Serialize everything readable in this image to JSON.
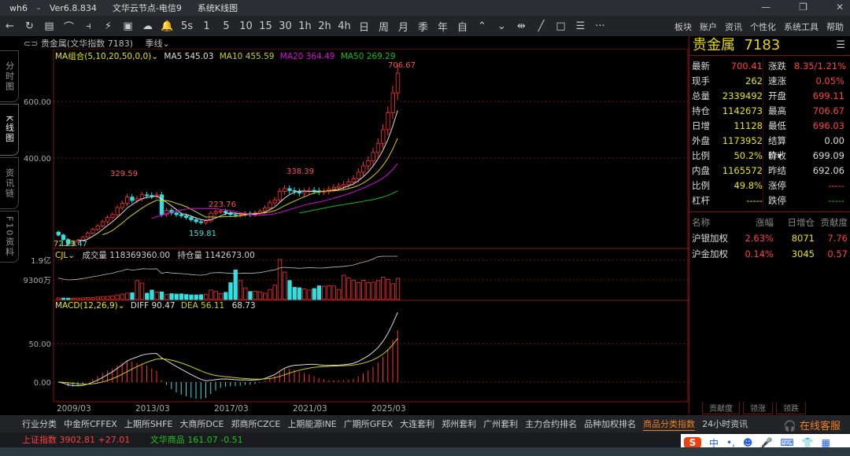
{
  "window": {
    "app": "wh6",
    "version": "Ver6.8.834",
    "server": "文华云节点-电信9",
    "view": "系统K线图"
  },
  "toolbar": {
    "buttons": [
      "←",
      "↻",
      "▤",
      "⌒",
      "⫞",
      "⚡",
      "▣",
      "☁",
      "🔔",
      "5s",
      "1",
      "5",
      "10",
      "15",
      "30",
      "1h",
      "2h",
      "4h",
      "日",
      "周",
      "月",
      "季",
      "年",
      "自",
      "⌃",
      "⌄",
      "⇹",
      "╱",
      "□",
      "☰",
      "···"
    ],
    "menus": [
      "板块",
      "账户",
      "资讯",
      "个性化",
      "系统工具",
      "帮助"
    ]
  },
  "side_tabs": [
    "分时图",
    "K线图",
    "资讯链",
    "F10资料"
  ],
  "instrument": {
    "name": "贵金属(文华指数 7183)",
    "period": "季线"
  },
  "ma_legend": {
    "label": "MA组合(5,10,20,50,0,0)",
    "ma5": "MA5 545.03",
    "ma10": "MA10 455.59",
    "ma20": "MA20 364.49",
    "ma50": "MA50 269.29"
  },
  "vol_legend": {
    "label": "CJL",
    "volume": "成交量 118369360.00",
    "oi": "持仓量 1142673.00"
  },
  "macd_legend": {
    "label": "MACD(12,26,9)",
    "diff": "DIFF 90.47",
    "dea": "DEA 56.11",
    "macd": "68.73"
  },
  "colors": {
    "up": "#ff3030",
    "down": "#30e0e0",
    "ma5": "#dddddd",
    "ma10": "#d0d000",
    "ma20": "#e000e0",
    "ma50": "#10c010"
  },
  "chart_data": {
    "type": "candlestick",
    "price_axis": {
      "ticks": [
        "600.00",
        "400.00"
      ],
      "range": [
        60,
        720
      ]
    },
    "vol_axis": {
      "ticks": [
        "1.9亿",
        "9300万"
      ]
    },
    "macd_axis": {
      "ticks": [
        "50.00",
        "0.00"
      ]
    },
    "x_ticks": [
      "2009/03",
      "2013/03",
      "2017/03",
      "2021/03",
      "2025/03"
    ],
    "annotations": {
      "high": "706.67",
      "low_first": "72.23",
      "low_first_b": "123.47",
      "peak2011": "329.59",
      "low2016": "159.81",
      "high2016": "223.76",
      "peak2020": "338.39"
    },
    "closes": [
      128,
      112,
      96,
      104,
      110,
      120,
      135,
      148,
      160,
      175,
      190,
      200,
      225,
      240,
      262,
      250,
      256,
      270,
      268,
      266,
      270,
      200,
      215,
      206,
      200,
      196,
      190,
      182,
      175,
      172,
      178,
      205,
      210,
      212,
      206,
      200,
      198,
      200,
      204,
      200,
      206,
      212,
      224,
      242,
      252,
      282,
      292,
      285,
      282,
      276,
      282,
      286,
      284,
      280,
      282,
      290,
      296,
      300,
      306,
      315,
      326,
      350,
      372,
      390,
      420,
      452,
      500,
      560,
      630,
      700
    ],
    "volumes": [
      800,
      700,
      650,
      600,
      700,
      800,
      900,
      1000,
      1200,
      1400,
      1500,
      1800,
      2200,
      2600,
      3000,
      3200,
      9000,
      7800,
      3000,
      4500,
      3500,
      3600,
      2500,
      2800,
      2600,
      2700,
      2400,
      2200,
      2200,
      2300,
      2500,
      4500,
      3800,
      2800,
      3400,
      8000,
      14000,
      9000,
      5500,
      3800,
      4000,
      3500,
      3000,
      4800,
      6800,
      19000,
      13000,
      9000,
      5800,
      5600,
      5000,
      4500,
      5200,
      6500,
      6300,
      6600,
      6400,
      4800,
      11500,
      10200,
      9200,
      8000,
      9100,
      8000,
      8200,
      9000,
      10600,
      9500,
      7500,
      10000
    ]
  },
  "quote": {
    "title": "贵金属",
    "code": "7183",
    "rows": [
      {
        "l1": "最新",
        "v1": "700.41",
        "c1": "red",
        "l2": "涨跌",
        "v2": "8.35/1.21%",
        "c2": "red"
      },
      {
        "l1": "现手",
        "v1": "262",
        "c1": "yel",
        "l2": "速涨",
        "v2": "0.05%",
        "c2": "red"
      },
      {
        "l1": "总量",
        "v1": "2339492",
        "c1": "yel",
        "l2": "开盘",
        "v2": "699.11",
        "c2": "red"
      },
      {
        "l1": "持仓",
        "v1": "1142673",
        "c1": "yel",
        "l2": "最高",
        "v2": "706.67",
        "c2": "red"
      },
      {
        "l1": "日增",
        "v1": "11128",
        "c1": "yel",
        "l2": "最低",
        "v2": "696.03",
        "c2": "red"
      },
      {
        "l1": "外盘",
        "v1": "1173952",
        "c1": "yel",
        "l2": "结算价▾",
        "v2": "0.00",
        "c2": "wht"
      },
      {
        "l1": "比例",
        "v1": "50.2%",
        "c1": "yel",
        "l2": "昨收",
        "v2": "699.09",
        "c2": "wht"
      },
      {
        "l1": "内盘",
        "v1": "1165572",
        "c1": "yel",
        "l2": "昨结",
        "v2": "692.06",
        "c2": "wht"
      },
      {
        "l1": "比例",
        "v1": "49.8%",
        "c1": "yel",
        "l2": "涨停",
        "v2": "-----",
        "c2": "red"
      },
      {
        "l1": "杠杆",
        "v1": "-----",
        "c1": "yel",
        "l2": "跌停",
        "v2": "-----",
        "c2": "grn"
      }
    ],
    "contrib_headers": [
      "名称",
      "涨幅",
      "日增仓",
      "贡献度"
    ],
    "contrib": [
      {
        "name": "沪银加权",
        "chg": "2.63%",
        "oi": "8071",
        "contrib": "7.76"
      },
      {
        "name": "沪金加权",
        "chg": "0.14%",
        "oi": "3045",
        "contrib": "0.57"
      }
    ],
    "tabs": [
      "贡献度",
      "领涨",
      "领跌"
    ]
  },
  "bottom_tabs": [
    "行业分类",
    "中金所CFFEX",
    "上期所SHFE",
    "大商所DCE",
    "郑商所CZCE",
    "上期能源INE",
    "广期所GFEX",
    "大连套利",
    "郑州套利",
    "广州套利",
    "主力合约排名",
    "品种加权排名",
    "商品分类指数",
    "24小时资讯"
  ],
  "service": "在线客服",
  "status": {
    "idx1_name": "上证指数",
    "idx1_val": "3902.81",
    "idx1_chg": "+27.01",
    "idx2_name": "文华商品",
    "idx2_val": "161.07",
    "idx2_chg": "-0.51"
  },
  "ime": {
    "lang": "中"
  }
}
